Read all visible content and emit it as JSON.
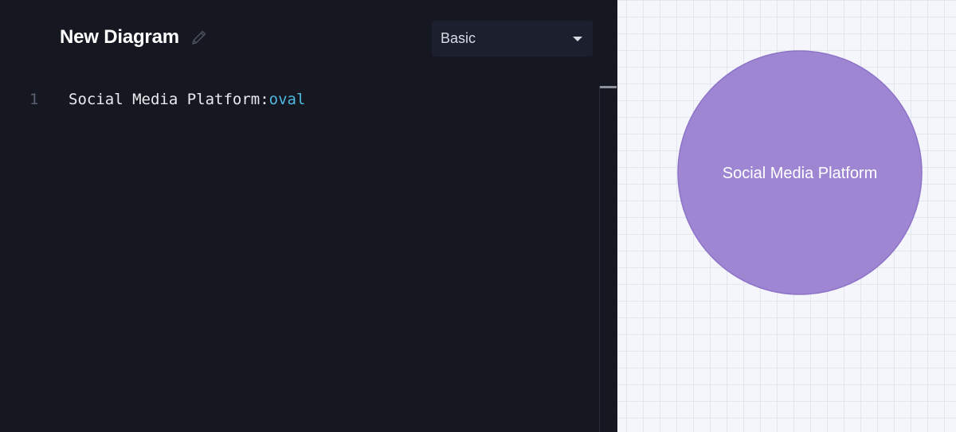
{
  "editor": {
    "title": "New Diagram",
    "edit_icon": "pencil-icon",
    "theme_select": {
      "value": "Basic"
    },
    "lines": [
      {
        "number": "1",
        "label_text": "Social Media Platform:",
        "shape_text": "oval"
      }
    ]
  },
  "preview": {
    "node": {
      "label": "Social Media Platform",
      "shape": "oval",
      "fill": "#9e86d2",
      "stroke": "#8e74c8"
    }
  },
  "colors": {
    "editor_background": "#151821",
    "keyword": "#4fb6e0",
    "canvas_background": "#f5f6fb"
  }
}
